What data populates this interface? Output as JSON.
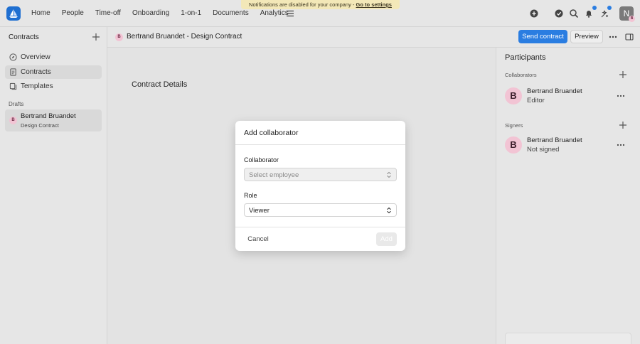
{
  "banner": {
    "text": "Notifications are disabled for your company - ",
    "link": "Go to settings"
  },
  "nav": {
    "links": [
      "Home",
      "People",
      "Time-off",
      "Onboarding",
      "1-on-1",
      "Documents",
      "Analytics"
    ],
    "user_initial": "N",
    "user_badge": "B",
    "notification_dot_color": "#2a7de1"
  },
  "sidebar": {
    "title": "Contracts",
    "items": [
      {
        "label": "Overview",
        "icon": "compass-icon"
      },
      {
        "label": "Contracts",
        "icon": "document-icon"
      },
      {
        "label": "Templates",
        "icon": "template-icon"
      }
    ],
    "drafts_label": "Drafts",
    "draft": {
      "initial": "B",
      "name": "Bertrand Bruandet",
      "subtitle": "Design Contract"
    }
  },
  "header": {
    "initial": "B",
    "title": "Bertrand Bruandet - Design Contract",
    "send_label": "Send contract",
    "preview_label": "Preview"
  },
  "main": {
    "section_title": "Contract Details"
  },
  "participants": {
    "title": "Participants",
    "collaborators_label": "Collaborators",
    "collaborator": {
      "initial": "B",
      "name": "Bertrand Bruandet",
      "status": "Editor"
    },
    "signers_label": "Signers",
    "signer": {
      "initial": "B",
      "name": "Bertrand Bruandet",
      "status": "Not signed"
    }
  },
  "modal": {
    "title": "Add collaborator",
    "collaborator_label": "Collaborator",
    "collaborator_placeholder": "Select employee",
    "role_label": "Role",
    "role_value": "Viewer",
    "cancel_label": "Cancel",
    "add_label": "Add"
  },
  "colors": {
    "accent": "#2a7de1",
    "avatar_pink": "#f2c4d4",
    "banner": "#f3e8b8"
  }
}
